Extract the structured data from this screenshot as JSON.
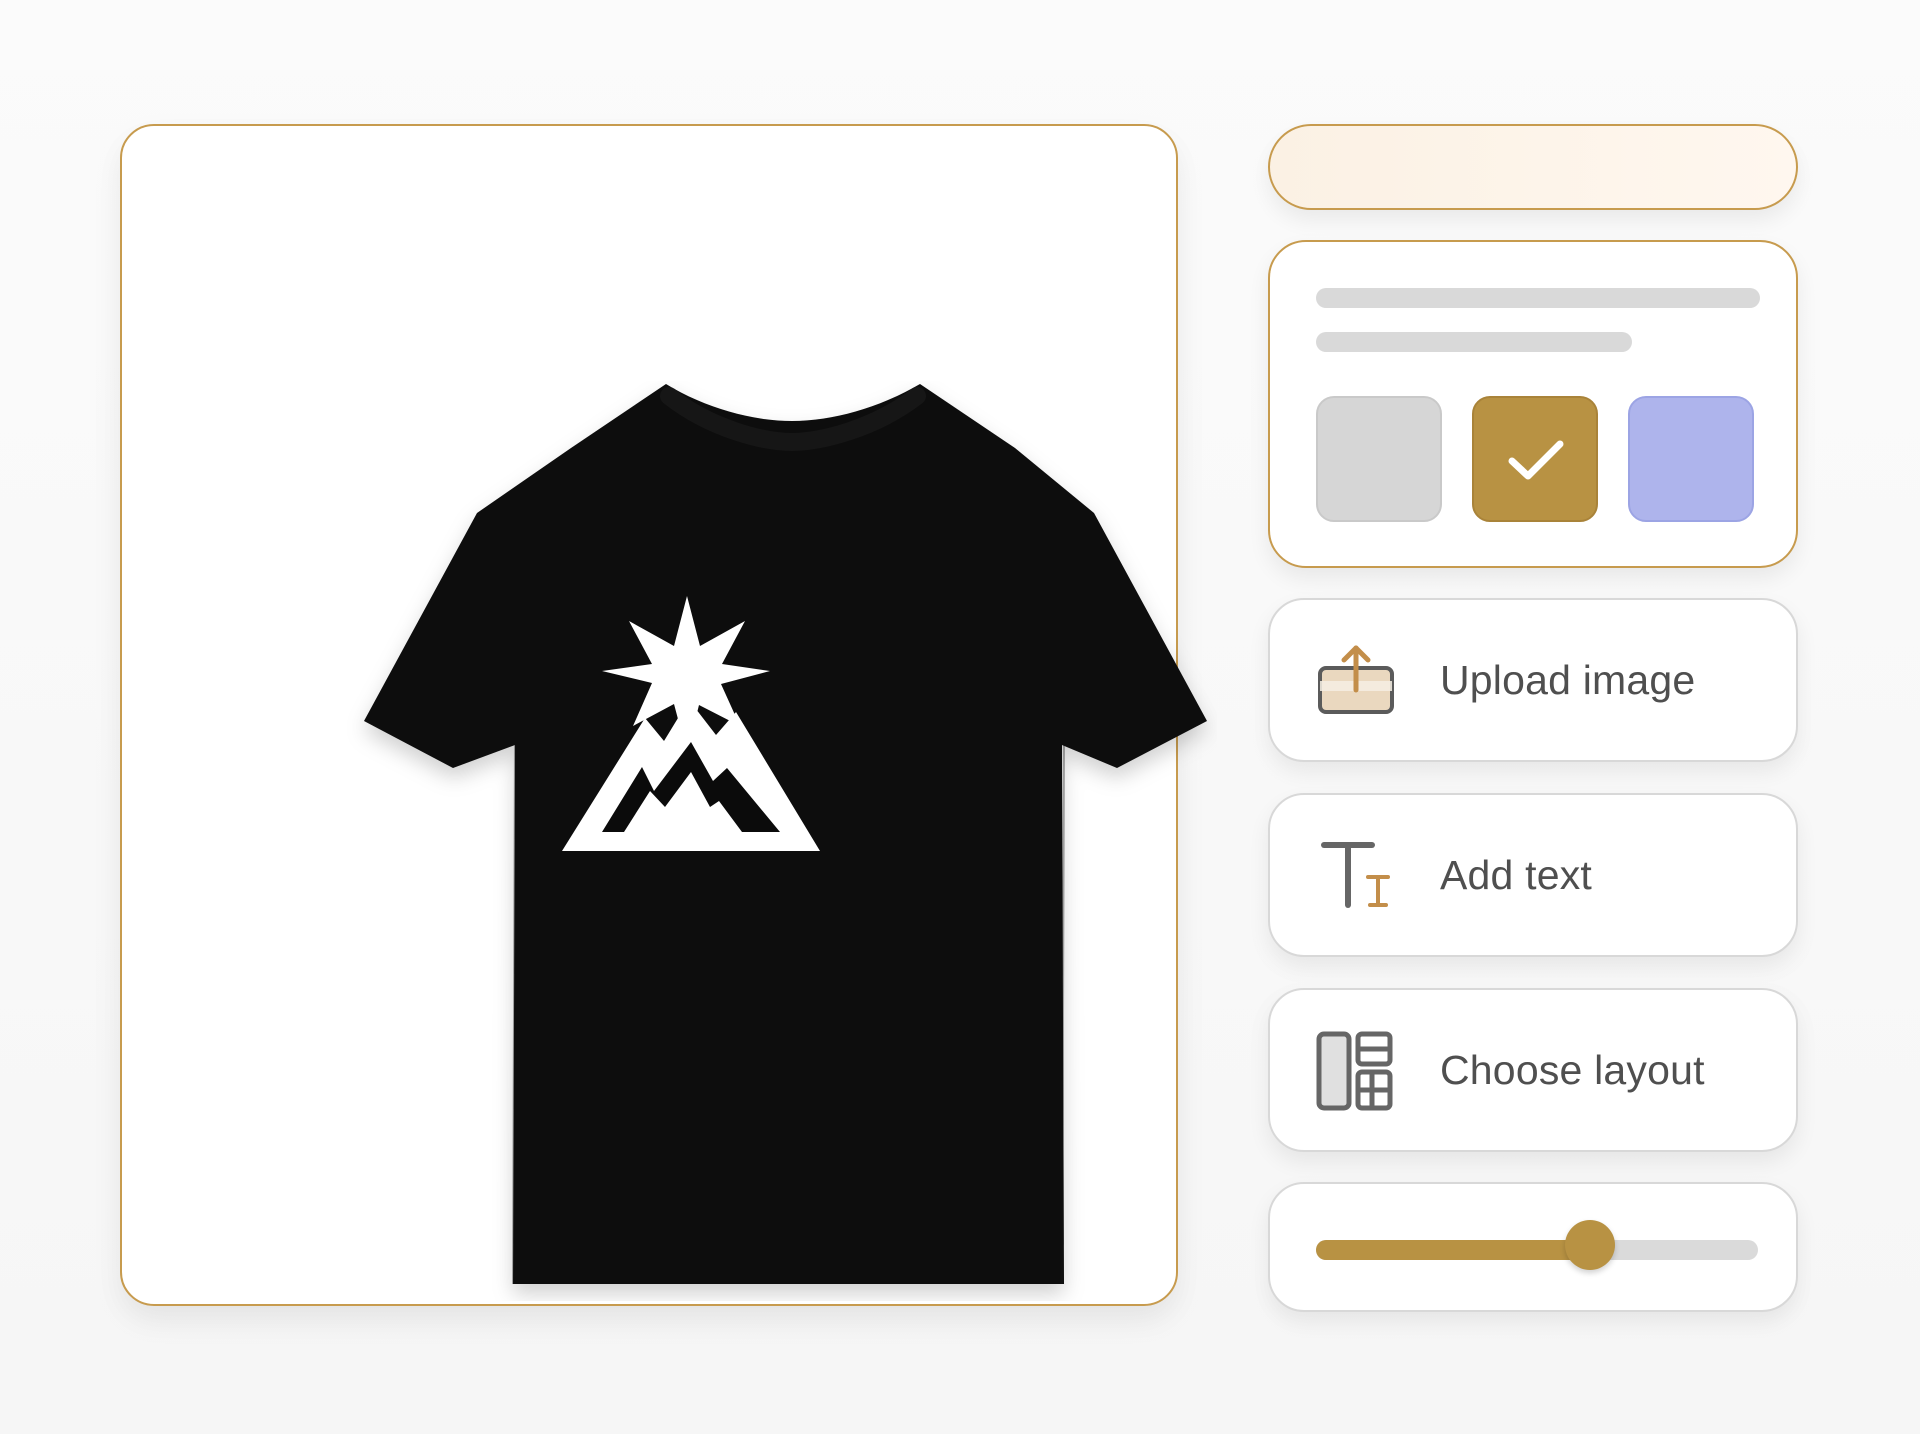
{
  "preview": {
    "shirt_color": "#0a0a0a",
    "graphic_icon_name": "mountain-star-icon"
  },
  "controls": {
    "swatches": [
      {
        "color": "#d6d6d6",
        "selected": false
      },
      {
        "color": "#b89243",
        "selected": true
      },
      {
        "color": "#aeb4ec",
        "selected": false
      }
    ],
    "actions": [
      {
        "label": "Upload image",
        "icon": "upload-image-icon"
      },
      {
        "label": "Add text",
        "icon": "text-icon"
      },
      {
        "label": "Choose layout",
        "icon": "layout-icon"
      }
    ],
    "slider": {
      "value": 0.62
    }
  }
}
